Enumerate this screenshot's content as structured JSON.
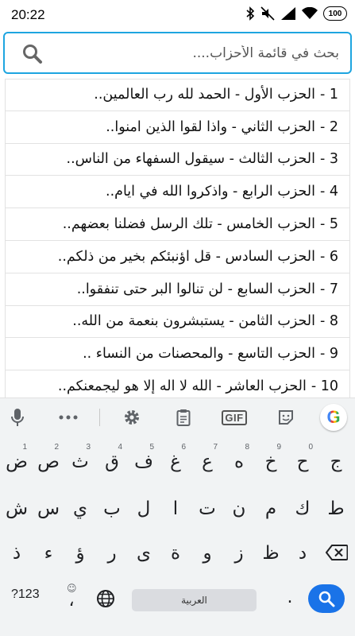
{
  "status_bar": {
    "time": "20:22",
    "battery": "100",
    "icons": [
      "bluetooth-icon",
      "mute-icon",
      "signal-icon",
      "wifi-icon",
      "battery-icon"
    ]
  },
  "search": {
    "placeholder": "بحث في قائمة الأحزاب....",
    "value": ""
  },
  "list": {
    "items": [
      {
        "num": "1 -",
        "title": "الحزب الأول  -  الحمد لله رب العالمين.."
      },
      {
        "num": "2 -",
        "title": "الحزب الثاني  -  واذا لقوا الذين امنوا.."
      },
      {
        "num": "3 -",
        "title": "الحزب الثالث  -  سيقول السفهاء من الناس.."
      },
      {
        "num": "4 -",
        "title": "الحزب الرابع  -  واذكروا الله في ايام.."
      },
      {
        "num": "5 -",
        "title": "الحزب الخامس  -  تلك الرسل فضلنا بعضهم.."
      },
      {
        "num": "6 -",
        "title": "الحزب السادس  -  قل اؤنبئكم بخير من ذلكم.."
      },
      {
        "num": "7 -",
        "title": "الحزب السابع  -  لن تنالوا البر حتى تنفقوا.."
      },
      {
        "num": "8 -",
        "title": "الحزب الثامن  -  يستبشرون بنعمة من الله.."
      },
      {
        "num": "9 -",
        "title": "الحزب التاسع  -  والمحصنات من النساء .."
      },
      {
        "num": "10 -",
        "title": "الحزب العاشر  -  الله لا اله إلا هو ليجمعنكم.."
      }
    ]
  },
  "keyboard": {
    "toolbar": {
      "gif_label": "GIF",
      "google_label": "G",
      "icons": [
        "mic-icon",
        "more-icon",
        "settings-icon",
        "clipboard-icon",
        "gif-icon",
        "sticker-icon",
        "google-icon"
      ]
    },
    "row1": [
      {
        "key": "ض",
        "hint": "1"
      },
      {
        "key": "ص",
        "hint": "2"
      },
      {
        "key": "ث",
        "hint": "3"
      },
      {
        "key": "ق",
        "hint": "4"
      },
      {
        "key": "ف",
        "hint": "5"
      },
      {
        "key": "غ",
        "hint": "6"
      },
      {
        "key": "ع",
        "hint": "7"
      },
      {
        "key": "ه",
        "hint": "8"
      },
      {
        "key": "خ",
        "hint": "9"
      },
      {
        "key": "ح",
        "hint": "0"
      },
      {
        "key": "ج",
        "hint": ""
      }
    ],
    "row2": [
      "ش",
      "س",
      "ي",
      "ب",
      "ل",
      "ا",
      "ت",
      "ن",
      "م",
      "ك",
      "ط"
    ],
    "row3": [
      "ذ",
      "ء",
      "ؤ",
      "ر",
      "ى",
      "ة",
      "و",
      "ز",
      "ظ",
      "د"
    ],
    "sym_label": "?123",
    "comma_key": "،",
    "space_label": "العربية",
    "period_key": ".",
    "emoji_hint": "☺"
  }
}
